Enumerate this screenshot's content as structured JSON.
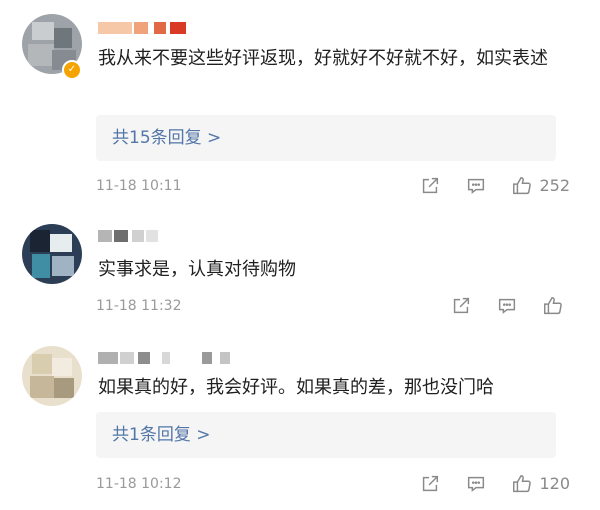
{
  "comments": [
    {
      "text": "我从来不要这些好评返现，好就好不好就不好，如实表述",
      "replies_label": "共15条回复 >",
      "time": "11-18 10:11",
      "likes": "252"
    },
    {
      "text": "实事求是，认真对待购物",
      "time": "11-18 11:32",
      "likes": ""
    },
    {
      "text": "如果真的好，我会好评。如果真的差，那也没门哈",
      "replies_label": "共1条回复 >",
      "time": "11-18 10:12",
      "likes": "120"
    }
  ],
  "icons": {
    "share": "share-icon",
    "comment": "comment-icon",
    "like": "thumbs-up-icon",
    "verified": "verified-badge-icon"
  },
  "colors": {
    "reply_link": "#5276a8",
    "reply_bg": "#f5f5f5",
    "meta_text": "#9a9a9a",
    "verified_badge": "#f5a300"
  }
}
